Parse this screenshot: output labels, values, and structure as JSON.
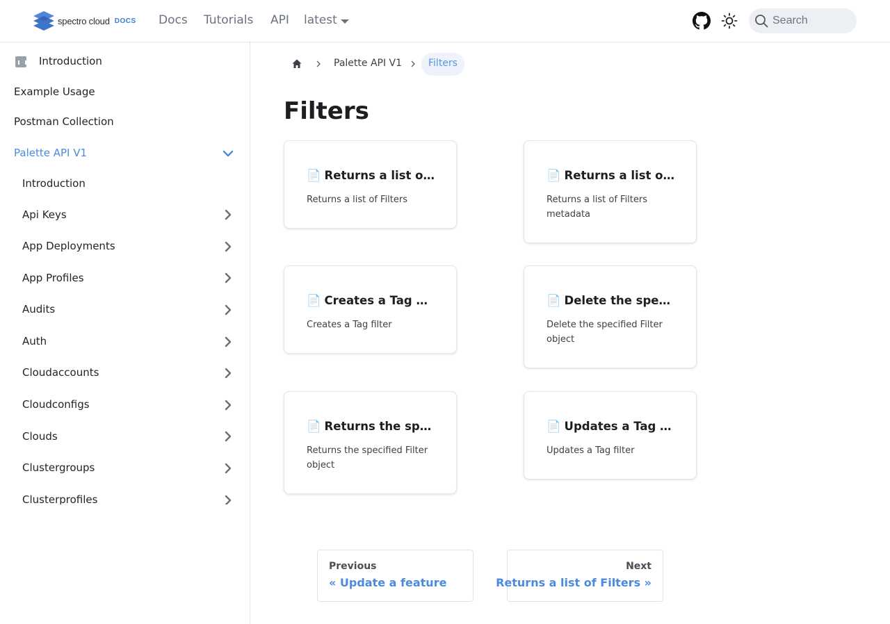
{
  "navbar": {
    "brand_text": "spectro cloud",
    "brand_docs": "DOCS",
    "links": [
      "Docs",
      "Tutorials",
      "API"
    ],
    "version": "latest",
    "search_placeholder": "Search"
  },
  "sidebar": {
    "items": [
      {
        "label": "Introduction"
      },
      {
        "label": "Example Usage"
      },
      {
        "label": "Postman Collection"
      },
      {
        "label": "Palette API V1"
      }
    ],
    "sub_items": [
      {
        "label": "Introduction"
      },
      {
        "label": "Api Keys"
      },
      {
        "label": "App Deployments"
      },
      {
        "label": "App Profiles"
      },
      {
        "label": "Audits"
      },
      {
        "label": "Auth"
      },
      {
        "label": "Cloudaccounts"
      },
      {
        "label": "Cloudconfigs"
      },
      {
        "label": "Clouds"
      },
      {
        "label": "Clustergroups"
      },
      {
        "label": "Clusterprofiles"
      }
    ]
  },
  "breadcrumb": {
    "parent": "Palette API V1",
    "current": "Filters"
  },
  "page_title": "Filters",
  "cards": [
    {
      "icon": "📄",
      "title": "Returns a list of Filters",
      "desc": "Returns a list of Filters"
    },
    {
      "icon": "📄",
      "title": "Returns a list of Filters metadata",
      "desc": "Returns a list of Filters metadata"
    },
    {
      "icon": "📄",
      "title": "Creates a Tag filter",
      "desc": "Creates a Tag filter"
    },
    {
      "icon": "📄",
      "title": "Delete the specified Filter object",
      "desc": "Delete the specified Filter object"
    },
    {
      "icon": "📄",
      "title": "Returns the specified Filter object",
      "desc": "Returns the specified Filter object"
    },
    {
      "icon": "📄",
      "title": "Updates a Tag filter",
      "desc": "Updates a Tag filter"
    }
  ],
  "pagination": {
    "prev_sub": "Previous",
    "prev_label": "« Update a feature",
    "next_sub": "Next",
    "next_label": "Returns a list of Filters »"
  },
  "colors": {
    "accent": "#4a8be0",
    "text": "#1c1e21",
    "muted": "#6b7280"
  }
}
